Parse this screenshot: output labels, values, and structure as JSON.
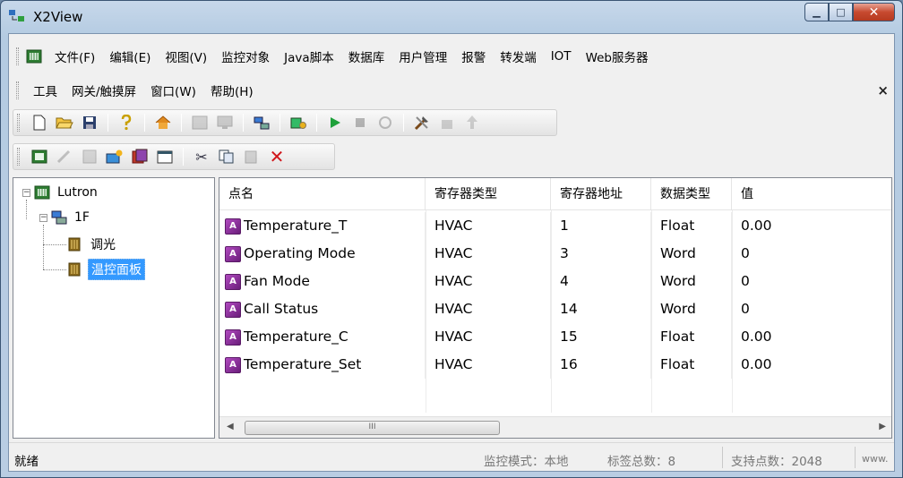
{
  "window": {
    "title": "X2View"
  },
  "menu": {
    "row1": [
      "文件(F)",
      "编辑(E)",
      "视图(V)",
      "监控对象",
      "Java脚本",
      "数据库",
      "用户管理",
      "报警",
      "转发端",
      "IOT",
      "Web服务器"
    ],
    "row2": [
      "工具",
      "网关/触摸屏",
      "窗口(W)",
      "帮助(H)"
    ]
  },
  "toolbar1": [
    "new-file-icon",
    "open-folder-icon",
    "save-icon",
    "help-icon",
    "home-icon",
    "device-icon",
    "monitor-icon",
    "network-icon",
    "config-icon",
    "run-icon",
    "stop-icon",
    "refresh-icon",
    "tools-icon",
    "load-icon",
    "upload-icon"
  ],
  "toolbar2": [
    "add-device-icon",
    "edit-icon",
    "table-icon",
    "new-folder-icon",
    "import-icon",
    "properties-icon",
    "cut-icon",
    "copy-icon",
    "paste-icon",
    "delete-icon"
  ],
  "tree": {
    "root": "Lutron",
    "floor": "1F",
    "children": [
      "调光",
      "温控面板"
    ],
    "selected": "温控面板"
  },
  "table": {
    "headers": [
      "点名",
      "寄存器类型",
      "寄存器地址",
      "数据类型",
      "值"
    ],
    "rows": [
      {
        "name": "Temperature_T",
        "reg_type": "HVAC",
        "address": "1",
        "data_type": "Float",
        "value": "0.00"
      },
      {
        "name": "Operating Mode",
        "reg_type": "HVAC",
        "address": "3",
        "data_type": "Word",
        "value": "0"
      },
      {
        "name": "Fan Mode",
        "reg_type": "HVAC",
        "address": "4",
        "data_type": "Word",
        "value": "0"
      },
      {
        "name": "Call Status",
        "reg_type": "HVAC",
        "address": "14",
        "data_type": "Word",
        "value": "0"
      },
      {
        "name": "Temperature_C",
        "reg_type": "HVAC",
        "address": "15",
        "data_type": "Float",
        "value": "0.00"
      },
      {
        "name": "Temperature_Set",
        "reg_type": "HVAC",
        "address": "16",
        "data_type": "Float",
        "value": "0.00"
      }
    ]
  },
  "scrollbar": {
    "thumb_grip": "III"
  },
  "status": {
    "ready": "就绪",
    "mode": "监控模式：本地",
    "tag_count": "标签总数：8",
    "points": "支持点数：2048",
    "site": "www."
  }
}
